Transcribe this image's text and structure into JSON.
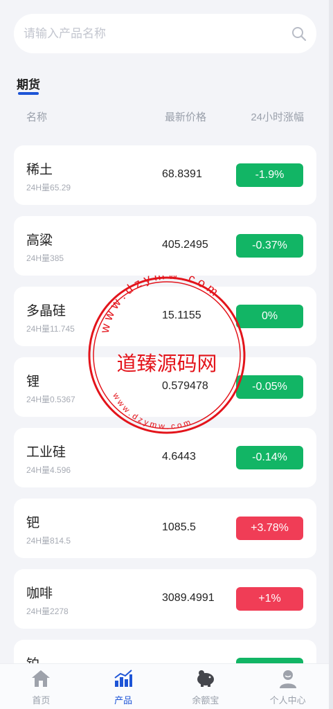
{
  "search": {
    "placeholder": "请输入产品名称"
  },
  "section": {
    "title": "期货"
  },
  "columns": {
    "name": "名称",
    "price": "最新价格",
    "change": "24小时涨幅"
  },
  "colors": {
    "up": "#f03d56",
    "down": "#12b565",
    "accent": "#1d54d6"
  },
  "products": [
    {
      "name": "稀土",
      "volume": "24H量65.29",
      "price": "68.8391",
      "change": "-1.9%",
      "trend": "down"
    },
    {
      "name": "高粱",
      "volume": "24H量385",
      "price": "405.2495",
      "change": "-0.37%",
      "trend": "down"
    },
    {
      "name": "多晶硅",
      "volume": "24H量11.745",
      "price": "15.1155",
      "change": "0%",
      "trend": "down"
    },
    {
      "name": "锂",
      "volume": "24H量0.5367",
      "price": "0.579478",
      "change": "-0.05%",
      "trend": "down"
    },
    {
      "name": "工业硅",
      "volume": "24H量4.596",
      "price": "4.6443",
      "change": "-0.14%",
      "trend": "down"
    },
    {
      "name": "钯",
      "volume": "24H量814.5",
      "price": "1085.5",
      "change": "+3.78%",
      "trend": "up"
    },
    {
      "name": "咖啡",
      "volume": "24H量2278",
      "price": "3089.4991",
      "change": "+1%",
      "trend": "up"
    },
    {
      "name": "铂",
      "volume": "",
      "price": "",
      "change": "",
      "trend": "down"
    }
  ],
  "watermark": {
    "text": "道臻源码网",
    "top_url": "w w w . d z y m w . c o m",
    "bottom_url": "w w w . d z y m w . c o m"
  },
  "tabs": [
    {
      "label": "首页",
      "icon": "home-icon",
      "active": false
    },
    {
      "label": "产品",
      "icon": "chart-icon",
      "active": true
    },
    {
      "label": "余额宝",
      "icon": "piggy-bank-icon",
      "active": false
    },
    {
      "label": "个人中心",
      "icon": "user-icon",
      "active": false
    }
  ]
}
